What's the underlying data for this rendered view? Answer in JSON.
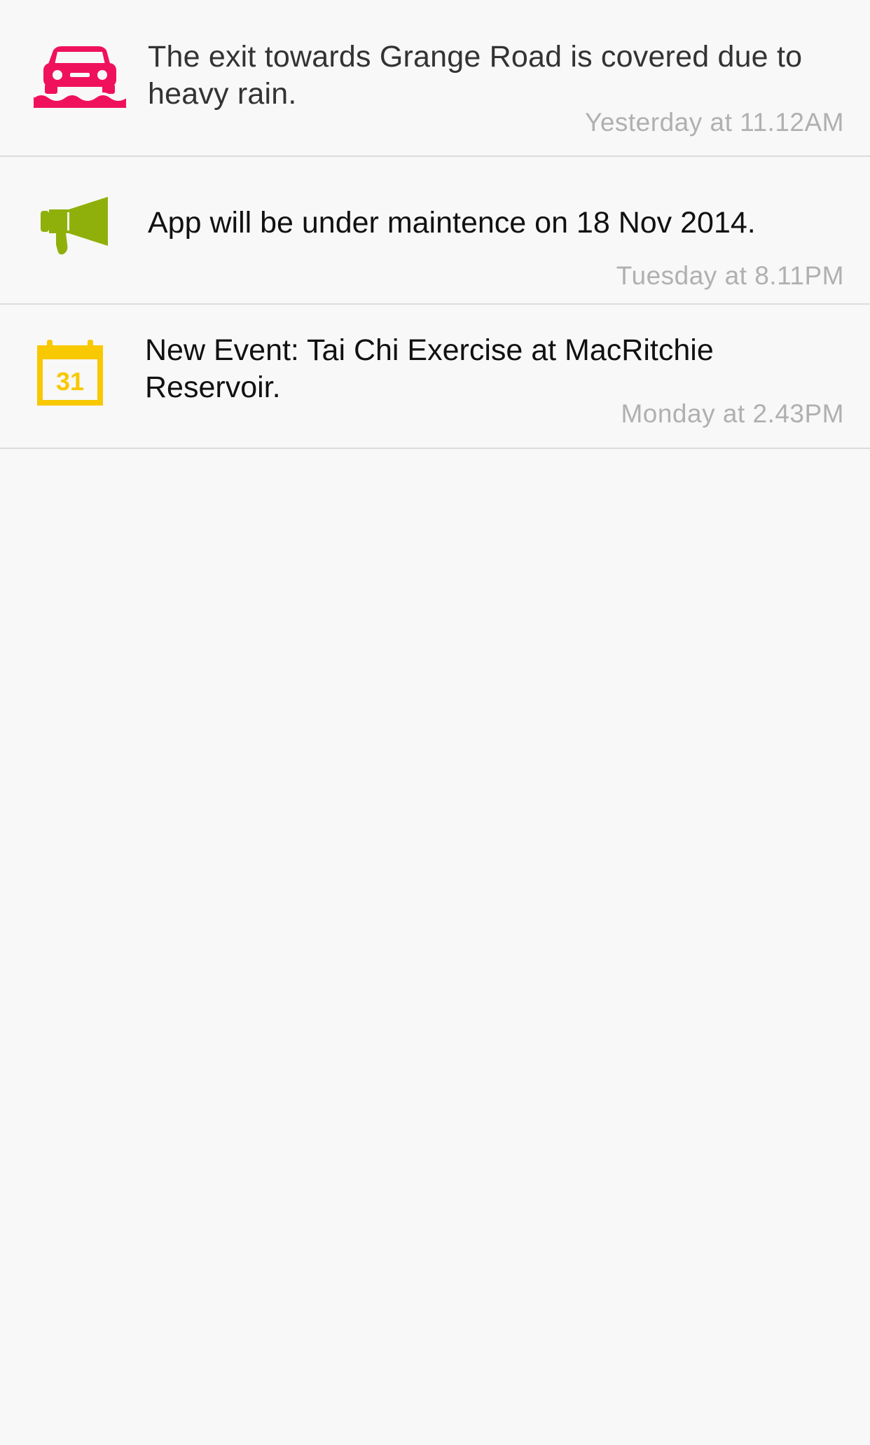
{
  "notifications": [
    {
      "icon": "flooded-car-icon",
      "icon_color": "#f0115d",
      "message": "The exit towards Grange Road is covered due to heavy rain.",
      "timestamp": "Yesterday at 11.12AM"
    },
    {
      "icon": "megaphone-icon",
      "icon_color": "#8fb00a",
      "message": "App will be under maintence on 18 Nov 2014.",
      "timestamp": "Tuesday at 8.11PM"
    },
    {
      "icon": "calendar-icon",
      "icon_color": "#f8c800",
      "icon_label": "31",
      "message": "New Event: Tai Chi Exercise at MacRitchie Reservoir.",
      "timestamp": "Monday at 2.43PM"
    }
  ]
}
